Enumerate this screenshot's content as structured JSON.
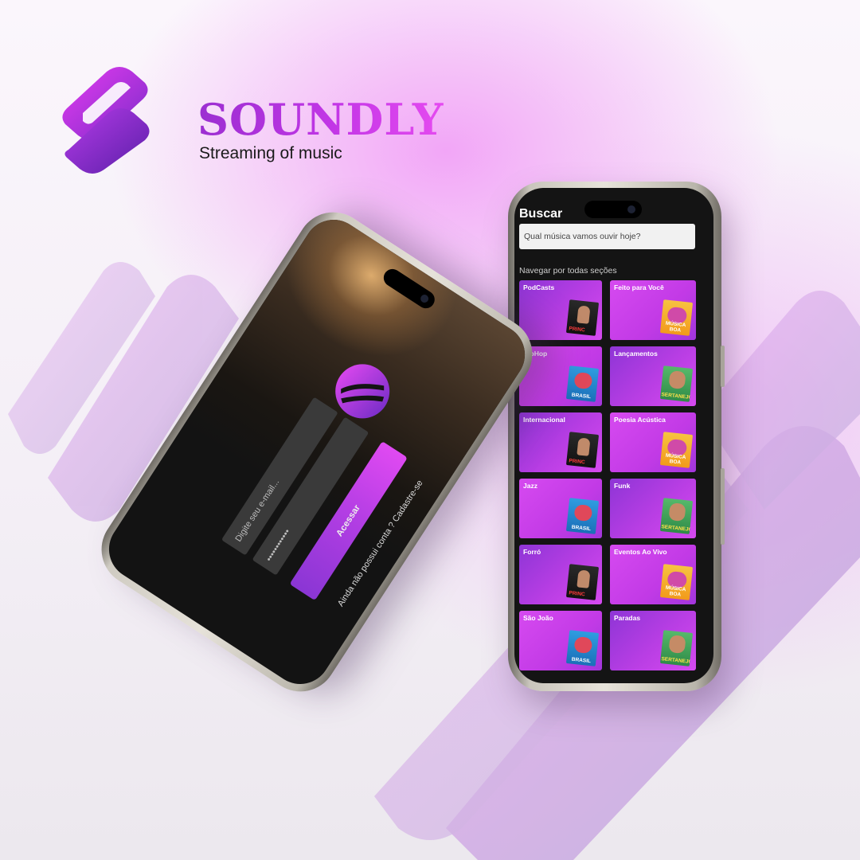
{
  "brand": {
    "name": "SOUNDLY",
    "tagline": "Streaming of music"
  },
  "colors": {
    "accent_purple": "#8e35d6",
    "accent_magenta": "#d64af0",
    "screen_dark": "#141414"
  },
  "search_screen": {
    "title": "Buscar",
    "search_placeholder": "Qual música vamos ouvir hoje?",
    "sections_label": "Navegar por todas seções",
    "categories": [
      {
        "label": "PodCasts",
        "cover": "princ-cover"
      },
      {
        "label": "Feito para Você",
        "cover": "musica-boa-cover"
      },
      {
        "label": "HipHop",
        "cover": "brasil-cover"
      },
      {
        "label": "Lançamentos",
        "cover": "sertanejo-cover"
      },
      {
        "label": "Internacional",
        "cover": "princ-cover"
      },
      {
        "label": "Poesia Acústica",
        "cover": "musica-boa-cover"
      },
      {
        "label": "Jazz",
        "cover": "brasil-cover"
      },
      {
        "label": "Funk",
        "cover": "sertanejo-cover"
      },
      {
        "label": "Forró",
        "cover": "princ-cover"
      },
      {
        "label": "Eventos Ao Vivo",
        "cover": "musica-boa-cover"
      },
      {
        "label": "São João",
        "cover": "brasil-cover"
      },
      {
        "label": "Paradas",
        "cover": "sertanejo-cover"
      }
    ],
    "cover_texts": {
      "princ": "PRINC",
      "brasil": "BRASIL",
      "musica_boa": "MÚSICA BOA",
      "sertanejo": "SERTANEJO"
    }
  },
  "login_screen": {
    "email_placeholder": "Digite seu e-mail...",
    "password_value": "••••••••••••",
    "submit_label": "Acessar",
    "signup_text": "Ainda não possui conta ? Cadastre-se"
  }
}
